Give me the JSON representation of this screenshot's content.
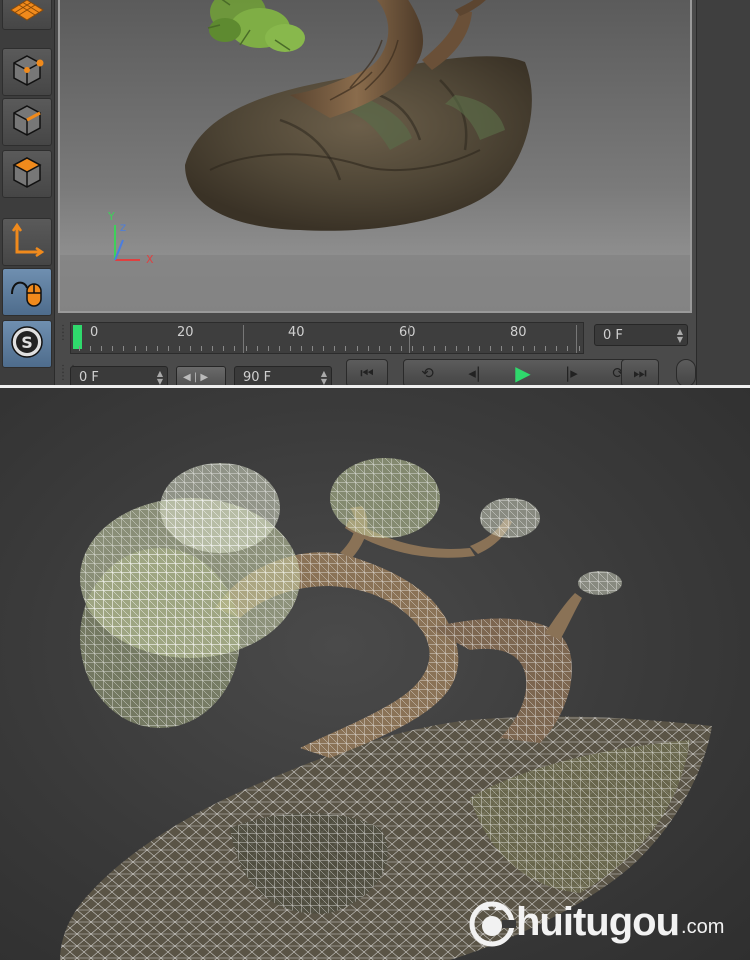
{
  "toolbar": {
    "tools": [
      {
        "icon": "grid-plane-icon"
      },
      {
        "icon": "points-mode-icon"
      },
      {
        "icon": "edges-mode-icon"
      },
      {
        "icon": "polygons-mode-icon"
      },
      {
        "icon": "axis-mode-icon"
      },
      {
        "icon": "tweak-mouse-icon",
        "active": true
      },
      {
        "icon": "snap-icon"
      }
    ]
  },
  "viewport": {
    "axes": {
      "y": "Y",
      "z": "Z",
      "x": "X"
    }
  },
  "timeline": {
    "ruler_labels": [
      "0",
      "20",
      "40",
      "60",
      "80"
    ],
    "current_frame": "0 F",
    "start_frame": "0 F",
    "end_frame": "90 F"
  },
  "playback": {
    "buttons": [
      "go-to-start-icon",
      "prev-key-icon",
      "step-back-icon",
      "play-icon",
      "step-forward-icon",
      "next-key-icon",
      "go-to-end-icon"
    ],
    "accent_color": "#2fd96c"
  },
  "colors": {
    "tool_accent": "#f08a1c",
    "axis_x": "#e04040",
    "axis_y": "#3ed05a",
    "axis_z": "#4a7de0"
  },
  "watermark": {
    "brand": "huitugou",
    "suffix": ".com"
  }
}
